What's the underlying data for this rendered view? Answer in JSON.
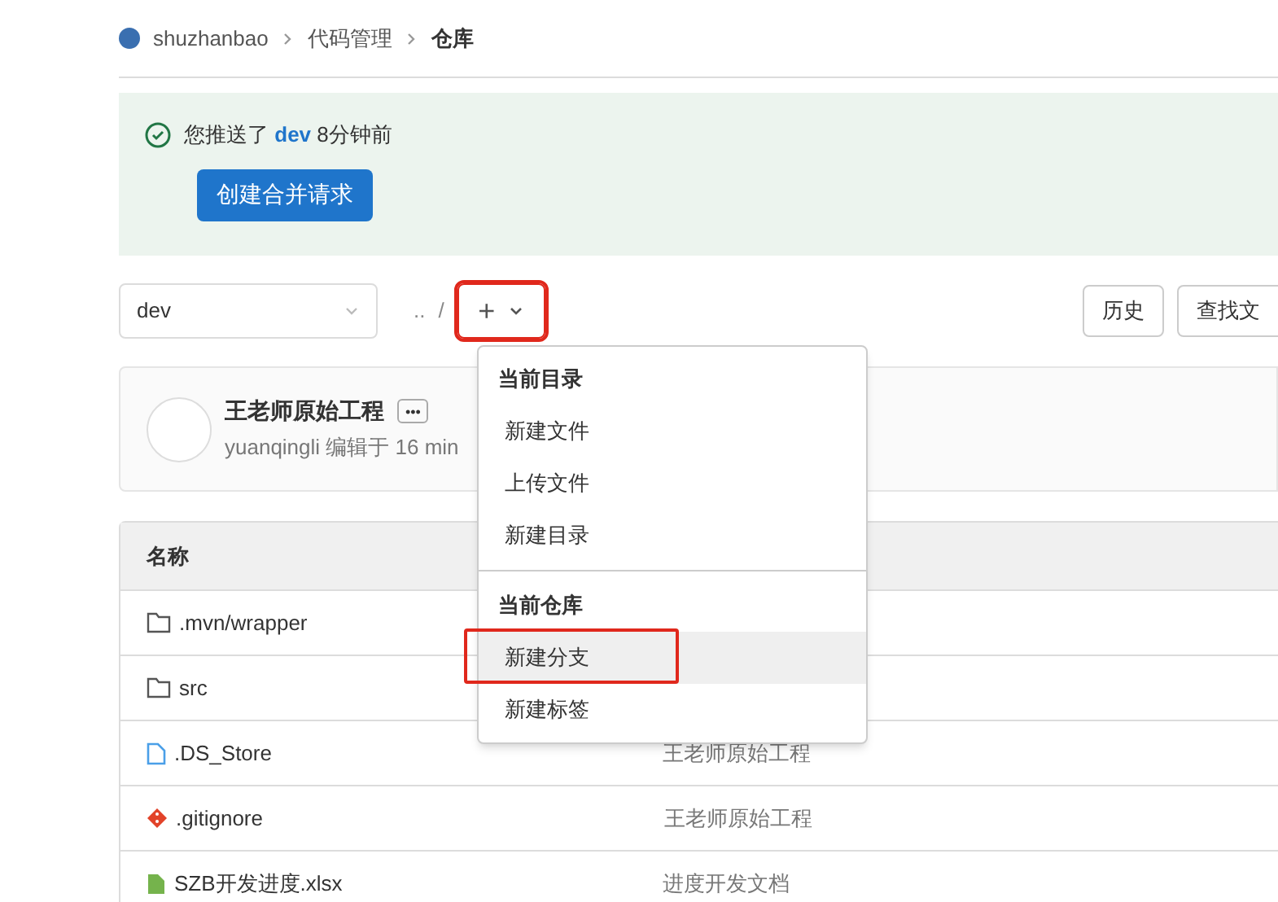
{
  "breadcrumb": [
    "shuzhanbao",
    "代码管理",
    "仓库"
  ],
  "alert": {
    "text": "您推送了 **dev** 8分钟前",
    "button": "创建合并请求"
  },
  "toolbar": {
    "branch": "dev",
    "path": "..",
    "separator": "/",
    "add_button": {
      "label": "+",
      "highlighted": true
    },
    "buttons": [
      "历史",
      "查找文"
    ]
  },
  "commit": {
    "title": "王老师原始工程",
    "more": "•••",
    "meta": "yuanqingli 编辑于 16 min"
  },
  "add_menu": {
    "sections": [
      {
        "header": "当前目录",
        "items": [
          {
            "label": "新建文件",
            "selected": false,
            "highlighted": false
          },
          {
            "label": "上传文件",
            "selected": false,
            "highlighted": false
          },
          {
            "label": "新建目录",
            "selected": false,
            "highlighted": false
          }
        ]
      },
      {
        "header": "当前仓库",
        "items": [
          {
            "label": "新建分支",
            "selected": true,
            "highlighted": true
          },
          {
            "label": "新建标签",
            "selected": false,
            "highlighted": false
          }
        ]
      }
    ]
  },
  "table": {
    "columns": [
      "名称"
    ],
    "rows": [
      {
        "kind": "folder",
        "name": ".mvn/wrapper"
      },
      {
        "kind": "folder",
        "name": "src"
      },
      {
        "kind": "file",
        "name": ".DS_Store",
        "message": "王老师原始工程"
      },
      {
        "kind": "git",
        "name": ".gitignore",
        "message": "王老师原始工程"
      },
      {
        "kind": "sheet",
        "name": "SZB开发进度.xlsx",
        "message": "进度开发文档"
      }
    ]
  }
}
